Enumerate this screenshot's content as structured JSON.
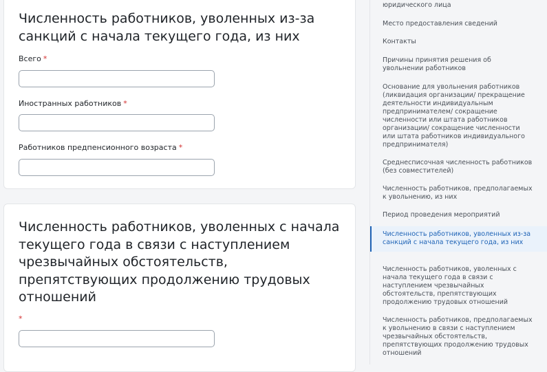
{
  "card1": {
    "title": "Численность работников, уволенных из-за санкций с начала текущего года, из них",
    "fields": [
      {
        "label": "Всего",
        "value": ""
      },
      {
        "label": "Иностранных работников",
        "value": ""
      },
      {
        "label": "Работников предпенсионного возраста",
        "value": ""
      }
    ]
  },
  "card2": {
    "title": "Численность работников, уволенных с начала текущего года в связи с наступлением чрезвычайных обстоятельств, препятствующих продолжению трудовых отношений",
    "field": {
      "label": "",
      "value": ""
    }
  },
  "required_mark": "*",
  "colors": {
    "accent": "#1e63b6",
    "required": "#d32f2f"
  },
  "sidebar": {
    "items": [
      {
        "label": "юридического лица",
        "active": false
      },
      {
        "label": "Место предоставления сведений",
        "active": false
      },
      {
        "label": "Контакты",
        "active": false
      },
      {
        "label": "Причины принятия решения об увольнении работников",
        "active": false
      },
      {
        "label": "Основание для увольнения работников (ликвидация организации/ прекращение деятельности индивидуальным предпринимателем/ сокращение численности или штата работников организации/ сокращение численности или штата работников индивидуального предпринимателя)",
        "active": false
      },
      {
        "label": "Среднесписочная численность работников (без совместителей)",
        "active": false
      },
      {
        "label": "Численность работников, предполагаемых к увольнению, из них",
        "active": false
      },
      {
        "label": "Период проведения мероприятий",
        "active": false
      },
      {
        "label": "Численность работников, уволенных из-за санкций с начала текущего года, из них",
        "active": true
      },
      {
        "label": "Численность работников, уволенных с начала текущего года в связи с наступлением чрезвычайных обстоятельств, препятствующих продолжению трудовых отношений",
        "active": false
      },
      {
        "label": "Численность работников, предполагаемых к увольнению в связи с наступлением чрезвычайных обстоятельств, препятствующих продолжению трудовых отношений",
        "active": false
      }
    ]
  }
}
